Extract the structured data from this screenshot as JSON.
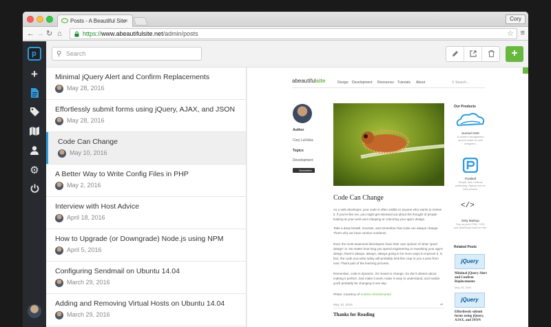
{
  "browser": {
    "tab_title": "Posts - A Beautiful Site",
    "profile": "Cory",
    "url_secure": "https://",
    "url_host": "www.abeautifulsite.net",
    "url_path": "/admin/posts"
  },
  "search": {
    "placeholder": "Search"
  },
  "sidebar": {
    "items": [
      {
        "icon": "plus-icon"
      },
      {
        "icon": "document-icon",
        "active": true
      },
      {
        "icon": "tag-icon"
      },
      {
        "icon": "map-icon"
      },
      {
        "icon": "user-icon"
      },
      {
        "icon": "gear-icon"
      },
      {
        "icon": "power-icon"
      }
    ]
  },
  "toolbar": {
    "edit_icon": "pencil-icon",
    "open_icon": "external-link-icon",
    "delete_icon": "trash-icon",
    "add_icon": "plus-icon"
  },
  "posts": [
    {
      "title": "Minimal jQuery Alert and Confirm Replacements",
      "date": "May 28, 2016"
    },
    {
      "title": "Effortlessly submit forms using jQuery, AJAX, and JSON",
      "date": "May 28, 2016"
    },
    {
      "title": "Code Can Change",
      "date": "May 10, 2016"
    },
    {
      "title": "A Better Way to Write Config Files in PHP",
      "date": "May 2, 2016"
    },
    {
      "title": "Interview with Host Advice",
      "date": "April 18, 2016"
    },
    {
      "title": "How to Upgrade (or Downgrade) Node.js using NPM",
      "date": "April 5, 2016"
    },
    {
      "title": "Configuring Sendmail on Ubuntu 14.04",
      "date": "March 29, 2016"
    },
    {
      "title": "Adding and Removing Virtual Hosts on Ubuntu 14.04",
      "date": "March 29, 2016"
    }
  ],
  "preview": {
    "brand_prefix": "abeautiful",
    "brand_suffix": "site",
    "nav": [
      "Design",
      "Development",
      "Resources",
      "Tutorials",
      "About"
    ],
    "search_placeholder": "Search...",
    "author_label": "Author",
    "author_name": "Cory LaViska",
    "topics_label": "Topics",
    "topic": "Development",
    "badge": "Newsletter",
    "title": "Code Can Change",
    "paragraphs": [
      "As a web developer, your code is often visible to anyone who wants to review it. If you're like me, you might get stressed out about the thought of people looking at your work and critiquing or criticizing your app's design.",
      "Take a deep breath, recenter, and remember that code can always change. That's why we have version numbers!",
      "Even the most seasoned developers have their own opinion of what \"good design\" is. No matter how long you spend engineering or reworking your app's design, there's always, always, always going to be more ways to improve it. In fact, the code you write today will probably look like crap to you a year from now. That's part of the learning process.",
      "Remember, code is dynamic. It's meant to change. So don't obsess about making it perfect. Just make it work, make it easy to understand, and realize you'll probably be changing it one day."
    ],
    "caption_prefix": "Photo: Courtesy of",
    "caption_credit": "Andrew Shmitsmantel",
    "date": "May 10, 2016",
    "thanks": "Thanks for Reading",
    "products_heading": "Our Products",
    "products": [
      {
        "name": "Surreal CMS",
        "desc": "A content management service made for web designers."
      },
      {
        "name": "Postleaf",
        "desc": "Simple, fast, minimal publishing. Signup free for beta access."
      },
      {
        "name": "Dirty Markup",
        "desc": "Tidy up your HTML, CSS, and JavaScript code for free."
      }
    ],
    "related_heading": "Related Posts",
    "related": [
      {
        "title": "Minimal jQuery Alert and Confirm Replacements",
        "date": "May 28, 2016",
        "logo": "jQuery"
      },
      {
        "title": "Effortlessly submit forms using jQuery, AJAX, and JSON",
        "date": "May 28, 2016",
        "logo": "jQuery"
      }
    ]
  }
}
